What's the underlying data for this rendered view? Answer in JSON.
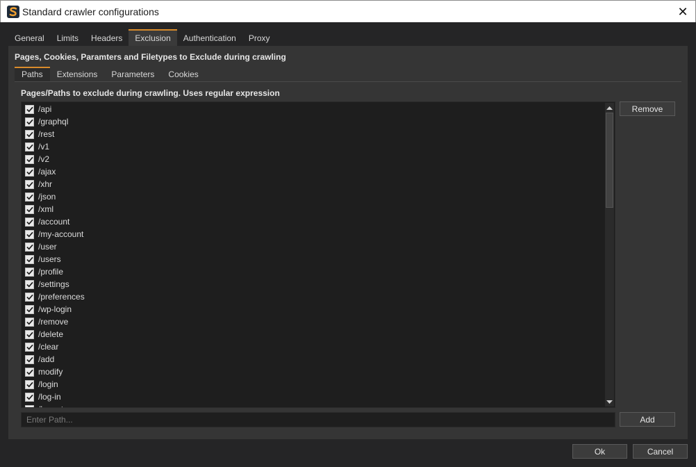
{
  "window": {
    "title": "Standard crawler configurations"
  },
  "main_tabs": [
    {
      "label": "General"
    },
    {
      "label": "Limits"
    },
    {
      "label": "Headers"
    },
    {
      "label": "Exclusion"
    },
    {
      "label": "Authentication"
    },
    {
      "label": "Proxy"
    }
  ],
  "active_main_tab": "Exclusion",
  "section": {
    "title": "Pages, Cookies, Paramters and Filetypes to Exclude during crawling"
  },
  "sub_tabs": [
    {
      "label": "Paths"
    },
    {
      "label": "Extensions"
    },
    {
      "label": "Parameters"
    },
    {
      "label": "Cookies"
    }
  ],
  "active_sub_tab": "Paths",
  "list": {
    "caption": "Pages/Paths to exclude during crawling. Uses regular expression",
    "items": [
      {
        "text": "/api",
        "checked": true
      },
      {
        "text": "/graphql",
        "checked": true
      },
      {
        "text": "/rest",
        "checked": true
      },
      {
        "text": "/v1",
        "checked": true
      },
      {
        "text": "/v2",
        "checked": true
      },
      {
        "text": "/ajax",
        "checked": true
      },
      {
        "text": "/xhr",
        "checked": true
      },
      {
        "text": "/json",
        "checked": true
      },
      {
        "text": "/xml",
        "checked": true
      },
      {
        "text": "/account",
        "checked": true
      },
      {
        "text": "/my-account",
        "checked": true
      },
      {
        "text": "/user",
        "checked": true
      },
      {
        "text": "/users",
        "checked": true
      },
      {
        "text": "/profile",
        "checked": true
      },
      {
        "text": "/settings",
        "checked": true
      },
      {
        "text": "/preferences",
        "checked": true
      },
      {
        "text": "/wp-login",
        "checked": true
      },
      {
        "text": "/remove",
        "checked": true
      },
      {
        "text": "/delete",
        "checked": true
      },
      {
        "text": "/clear",
        "checked": true
      },
      {
        "text": "/add",
        "checked": true
      },
      {
        "text": "modify",
        "checked": true
      },
      {
        "text": "/login",
        "checked": true
      },
      {
        "text": "/log-in",
        "checked": true
      },
      {
        "text": "/logout",
        "checked": true
      }
    ]
  },
  "buttons": {
    "remove": "Remove",
    "add": "Add",
    "ok": "Ok",
    "cancel": "Cancel"
  },
  "input": {
    "placeholder": "Enter Path...",
    "value": ""
  },
  "colors": {
    "accent": "#d98b2b",
    "background": "#252526",
    "panel": "#353535",
    "list_bg": "#1e1e1e"
  }
}
